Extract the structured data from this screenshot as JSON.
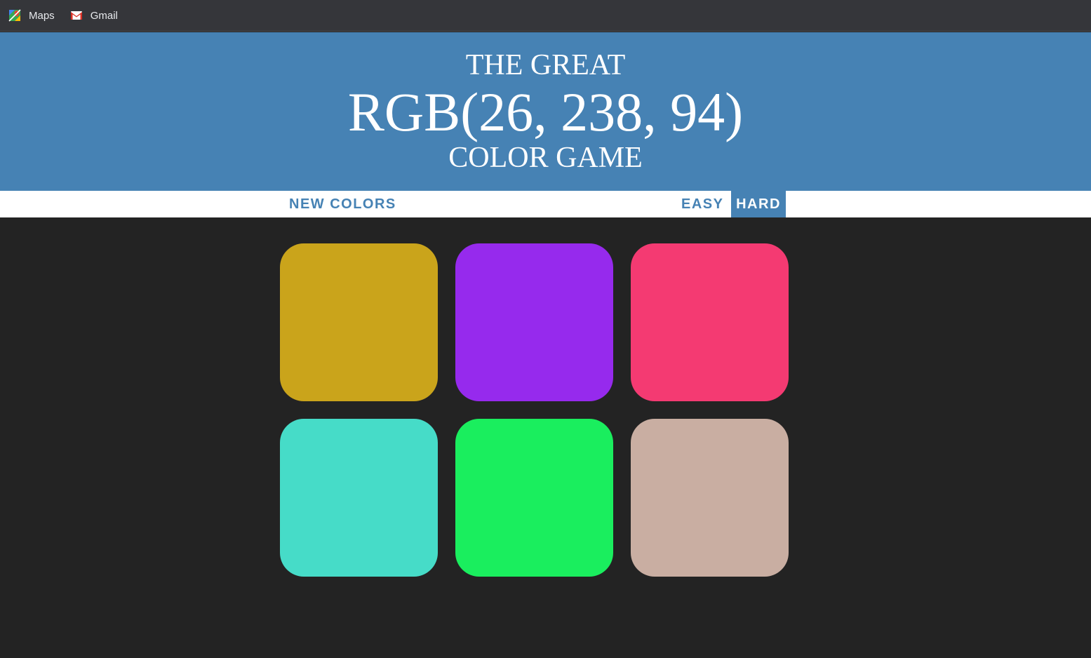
{
  "bookmarks": [
    {
      "label": "Maps",
      "icon": "maps-icon"
    },
    {
      "label": "Gmail",
      "icon": "gmail-icon"
    }
  ],
  "header": {
    "line1": "THE GREAT",
    "target_rgb": "RGB(26, 238, 94)",
    "line3": "COLOR GAME"
  },
  "controls": {
    "new_colors": "NEW COLORS",
    "message": "",
    "easy": "EASY",
    "hard": "HARD",
    "selected_mode": "hard"
  },
  "colors": {
    "background": "#232323",
    "header": "#4682b4",
    "accent": "#4682b4"
  },
  "squares": [
    "#caa41b",
    "#962aed",
    "#f43a72",
    "#46dcc8",
    "#1aee5e",
    "#c9aea2"
  ]
}
